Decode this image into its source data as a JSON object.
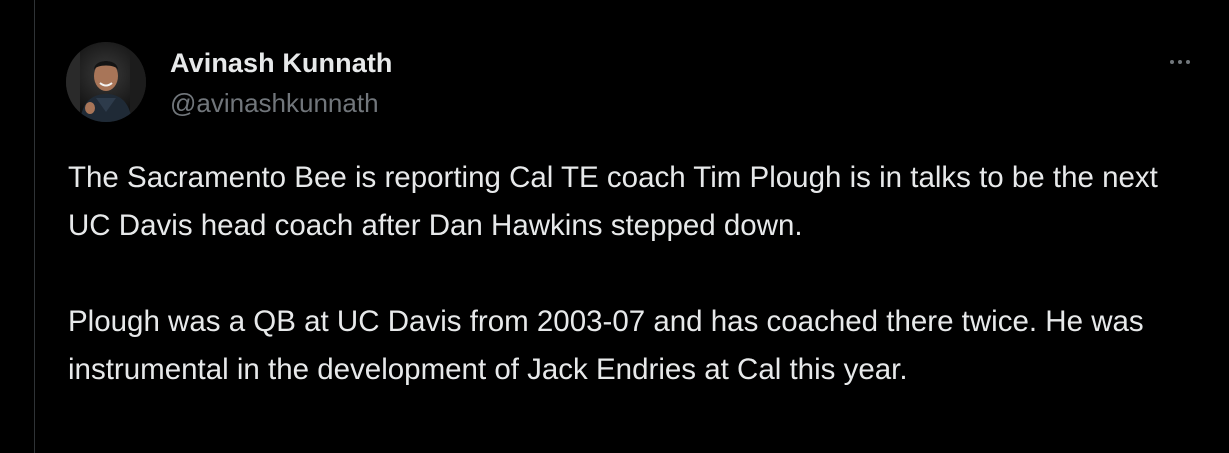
{
  "tweet": {
    "display_name": "Avinash Kunnath",
    "handle": "@avinashkunnath",
    "more_icon": "more-horizontal-icon",
    "paragraphs": [
      "The Sacramento Bee is reporting Cal TE coach Tim Plough is in talks to be the next UC Davis head coach after Dan Hawkins stepped down.",
      "Plough was a QB at UC Davis from 2003-07 and has coached there twice. He was instrumental in the development of Jack Endries at Cal this year."
    ]
  },
  "colors": {
    "background": "#000000",
    "text_primary": "#e7e9ea",
    "text_secondary": "#71767b",
    "divider": "#2f3336"
  }
}
